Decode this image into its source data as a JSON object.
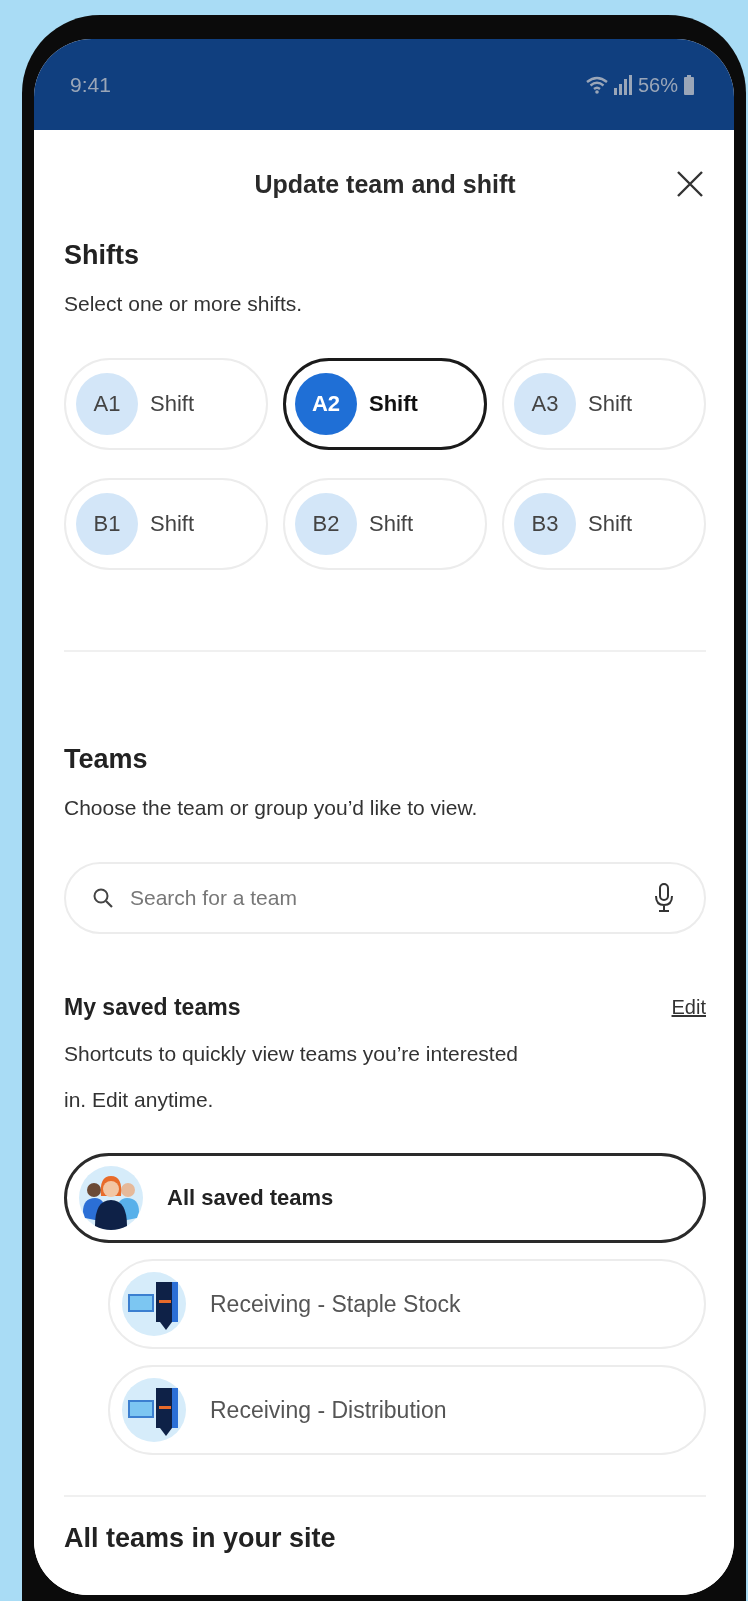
{
  "status_bar": {
    "time": "9:41",
    "battery": "56%"
  },
  "sheet": {
    "title": "Update team and shift"
  },
  "shifts": {
    "heading": "Shifts",
    "hint": "Select one or more shifts.",
    "items": [
      {
        "code": "A1",
        "label": "Shift",
        "selected": false
      },
      {
        "code": "A2",
        "label": "Shift",
        "selected": true
      },
      {
        "code": "A3",
        "label": "Shift",
        "selected": false
      },
      {
        "code": "B1",
        "label": "Shift",
        "selected": false
      },
      {
        "code": "B2",
        "label": "Shift",
        "selected": false
      },
      {
        "code": "B3",
        "label": "Shift",
        "selected": false
      }
    ]
  },
  "teams": {
    "heading": "Teams",
    "hint": "Choose the team or group you’d like to view.",
    "search": {
      "placeholder": "Search for a team"
    }
  },
  "saved": {
    "heading": "My saved teams",
    "edit": "Edit",
    "hint": "Shortcuts to quickly view teams you’re interested in. Edit anytime.",
    "items": [
      {
        "kind": "group",
        "label": "All saved teams",
        "selected": true
      },
      {
        "kind": "team",
        "label": "Receiving - Staple Stock",
        "selected": false
      },
      {
        "kind": "team",
        "label": "Receiving - Distribution",
        "selected": false
      }
    ]
  },
  "all_teams": {
    "heading": "All teams in your site"
  }
}
